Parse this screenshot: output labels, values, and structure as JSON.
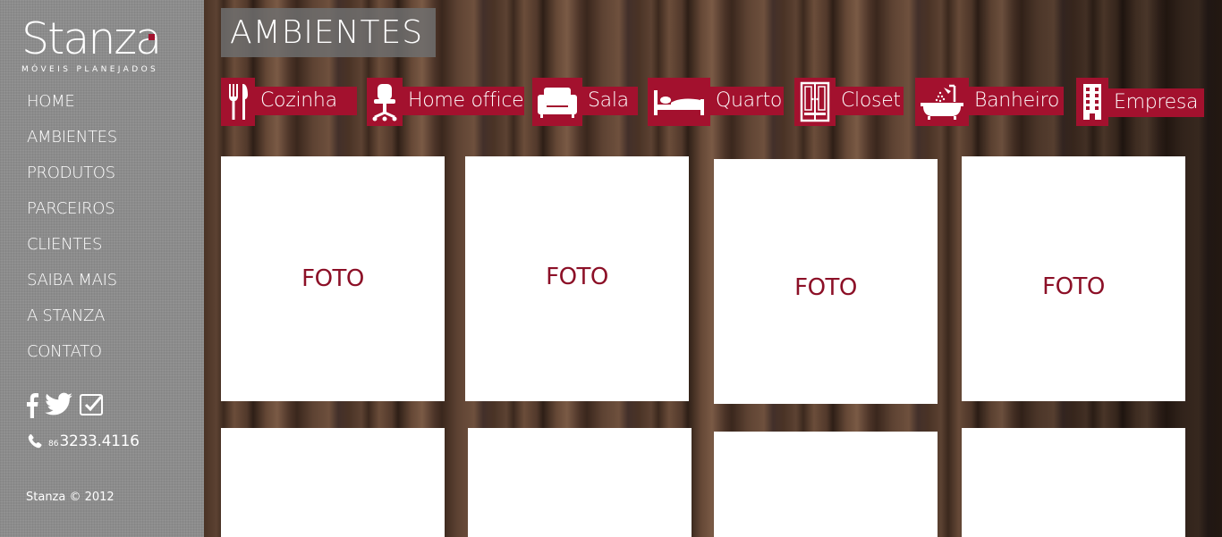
{
  "brand": {
    "name": "Stanza",
    "tagline": "MÓVEIS PLANEJADOS",
    "accent_color": "#a3112e"
  },
  "nav": {
    "items": [
      {
        "label": "HOME"
      },
      {
        "label": "AMBIENTES"
      },
      {
        "label": "PRODUTOS"
      },
      {
        "label": "PARCEIROS"
      },
      {
        "label": "CLIENTES"
      },
      {
        "label": "SAIBA MAIS"
      },
      {
        "label": "A STANZA"
      },
      {
        "label": "CONTATO"
      }
    ]
  },
  "social": {
    "icons": [
      "facebook-icon",
      "twitter-icon",
      "foursquare-icon"
    ]
  },
  "contact": {
    "phone_icon": "phone-icon",
    "area_code": "86",
    "phone": "3233.4116"
  },
  "footer": {
    "copyright": "Stanza © 2012"
  },
  "page": {
    "title": "AMBIENTES"
  },
  "categories": [
    {
      "label": "Cozinha",
      "icon": "cutlery-icon"
    },
    {
      "label": "Home office",
      "icon": "office-chair-icon"
    },
    {
      "label": "Sala",
      "icon": "armchair-icon"
    },
    {
      "label": "Quarto",
      "icon": "bed-icon"
    },
    {
      "label": "Closet",
      "icon": "wardrobe-icon"
    },
    {
      "label": "Banheiro",
      "icon": "bathtub-icon"
    },
    {
      "label": "Empresa",
      "icon": "building-icon"
    }
  ],
  "photos": [
    {
      "label": "FOTO"
    },
    {
      "label": "FOTO"
    },
    {
      "label": "FOTO"
    },
    {
      "label": "FOTO"
    },
    {
      "label": ""
    },
    {
      "label": ""
    },
    {
      "label": ""
    },
    {
      "label": ""
    }
  ]
}
